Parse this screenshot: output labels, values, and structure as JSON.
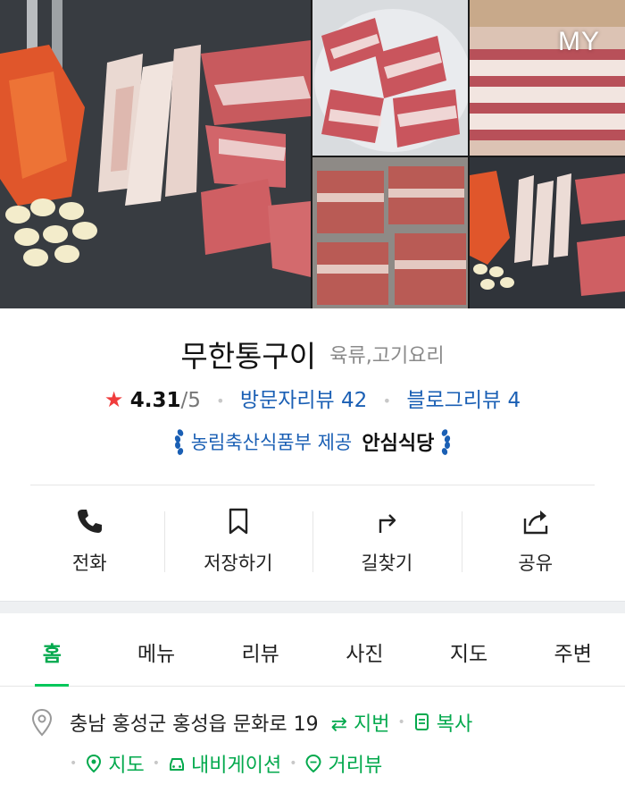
{
  "gallery": {
    "badge": "MY",
    "photos": [
      "grilled-pork-belly-on-griddle",
      "sliced-pork-belly-bowl",
      "packaged-pork-belly-strips",
      "raw-pork-belly-blocks",
      "grilled-pork-belly-with-kimchi"
    ]
  },
  "place": {
    "name": "무한통구이",
    "category": "육류,고기요리",
    "rating_star": "★",
    "rating": "4.31",
    "rating_max": "/5",
    "visitor_reviews": "방문자리뷰 42",
    "blog_reviews": "블로그리뷰 4",
    "cert_text": "농림축산식품부 제공",
    "cert_badge": "안심식당"
  },
  "actions": [
    {
      "label": "전화",
      "icon": "phone-icon"
    },
    {
      "label": "저장하기",
      "icon": "bookmark-icon"
    },
    {
      "label": "길찾기",
      "icon": "directions-icon"
    },
    {
      "label": "공유",
      "icon": "share-icon"
    }
  ],
  "tabs": [
    {
      "label": "홈",
      "active": true
    },
    {
      "label": "메뉴",
      "active": false
    },
    {
      "label": "리뷰",
      "active": false
    },
    {
      "label": "사진",
      "active": false
    },
    {
      "label": "지도",
      "active": false
    },
    {
      "label": "주변",
      "active": false
    }
  ],
  "address": {
    "text": "충남 홍성군 홍성읍 문화로 19",
    "lot_number": "⇄ 지번",
    "copy": "복사",
    "map": "지도",
    "navigation": "내비게이션",
    "distance": "거리뷰"
  },
  "colors": {
    "accent_green": "#03c75a",
    "link_blue": "#1a5fb4",
    "star_red": "#f03c3c"
  }
}
